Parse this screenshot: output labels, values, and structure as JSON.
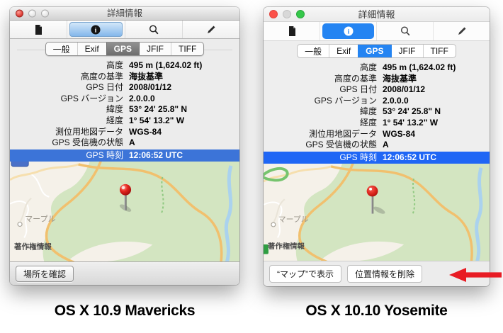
{
  "window": {
    "title": "詳細情報",
    "tabs": [
      "一般",
      "Exif",
      "GPS",
      "JFIF",
      "TIFF"
    ],
    "selected_tab": "GPS",
    "rows": [
      {
        "label": "高度",
        "value": "495 m (1,624.02 ft)"
      },
      {
        "label": "高度の基準",
        "value": "海抜基準"
      },
      {
        "label": "GPS 日付",
        "value": "2008/01/12"
      },
      {
        "label": "GPS バージョン",
        "value": "2.0.0.0"
      },
      {
        "label": "緯度",
        "value": "53° 24' 25.8\" N"
      },
      {
        "label": "経度",
        "value": "1° 54' 13.2\" W"
      },
      {
        "label": "測位用地図データ",
        "value": "WGS-84"
      },
      {
        "label": "GPS 受信機の状態",
        "value": "A"
      }
    ],
    "selected_row": {
      "label": "GPS 時刻",
      "value": "12:06:52 UTC"
    },
    "map": {
      "place_label": "マープル",
      "copyright": "著作権情報"
    },
    "toolbar_icons": [
      "document-icon",
      "info-icon",
      "search-icon",
      "pencil-icon"
    ]
  },
  "mavericks": {
    "caption": "OS X 10.9 Mavericks",
    "confirm_button": "場所を確認",
    "selection_color": "#3c74d8",
    "toolbar_highlight": "#84b7eb"
  },
  "yosemite": {
    "caption": "OS X 10.10 Yosemite",
    "show_in_maps_button": "“マップ”で表示",
    "remove_location_button": "位置情報を削除",
    "selection_color": "#1f66f5",
    "accent_color": "#2484f2"
  },
  "annotation": {
    "arrow_color": "#e81c24"
  }
}
